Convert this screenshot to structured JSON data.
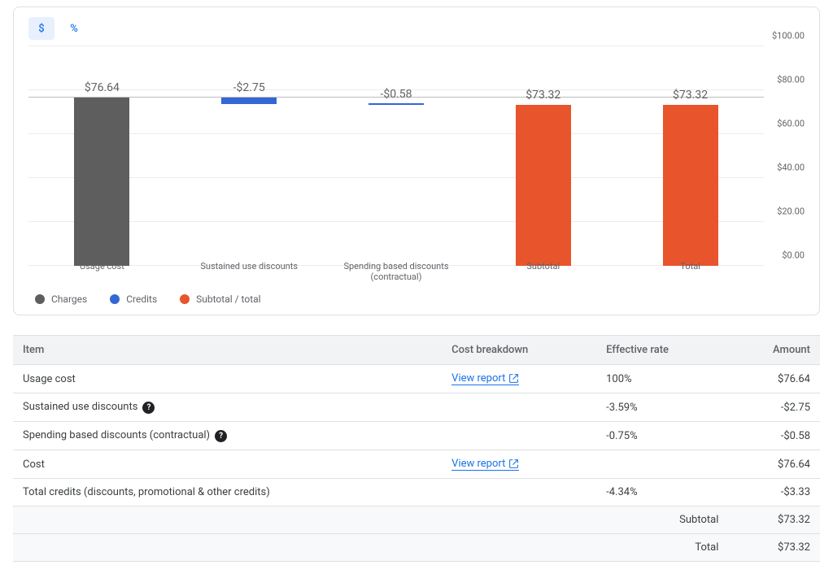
{
  "tabs": {
    "dollar": "$",
    "percent": "%"
  },
  "chart_data": {
    "type": "bar",
    "ylim": [
      0,
      100
    ],
    "ylabel": "",
    "xlabel": "",
    "title": "",
    "baseline": 76.64,
    "categories": [
      "Usage cost",
      "Sustained use discounts",
      "Spending based discounts (contractual)",
      "Subtotal",
      "Total"
    ],
    "series": [
      {
        "name": "Charges",
        "color": "#5e5e5e",
        "values": [
          76.64,
          null,
          null,
          null,
          null
        ]
      },
      {
        "name": "Credits",
        "color": "#3367d6",
        "values": [
          null,
          -2.75,
          -0.58,
          null,
          null
        ]
      },
      {
        "name": "Subtotal / total",
        "color": "#e8552d",
        "values": [
          null,
          null,
          null,
          73.32,
          73.32
        ]
      }
    ],
    "value_labels": [
      "$76.64",
      "-$2.75",
      "-$0.58",
      "$73.32",
      "$73.32"
    ],
    "y_ticks": [
      "$0.00",
      "$20.00",
      "$40.00",
      "$60.00",
      "$80.00",
      "$100.00"
    ]
  },
  "legend": [
    {
      "label": "Charges",
      "color": "#5e5e5e"
    },
    {
      "label": "Credits",
      "color": "#3367d6"
    },
    {
      "label": "Subtotal / total",
      "color": "#e8552d"
    }
  ],
  "table": {
    "headers": {
      "item": "Item",
      "breakdown": "Cost breakdown",
      "rate": "Effective rate",
      "amount": "Amount"
    },
    "link_label": "View report",
    "rows": [
      {
        "item": "Usage cost",
        "breakdown_link": true,
        "rate": "100%",
        "amount": "$76.64"
      },
      {
        "item": "Sustained use discounts",
        "help": true,
        "rate": "-3.59%",
        "amount": "-$2.75"
      },
      {
        "item": "Spending based discounts (contractual)",
        "help": true,
        "rate": "-0.75%",
        "amount": "-$0.58"
      },
      {
        "item": "Cost",
        "breakdown_link": true,
        "rate": "",
        "amount": "$76.64"
      },
      {
        "item": "Total credits (discounts, promotional & other credits)",
        "rate": "-4.34%",
        "amount": "-$3.33"
      }
    ],
    "footer": [
      {
        "label": "Subtotal",
        "amount": "$73.32"
      },
      {
        "label": "Total",
        "amount": "$73.32"
      }
    ]
  }
}
